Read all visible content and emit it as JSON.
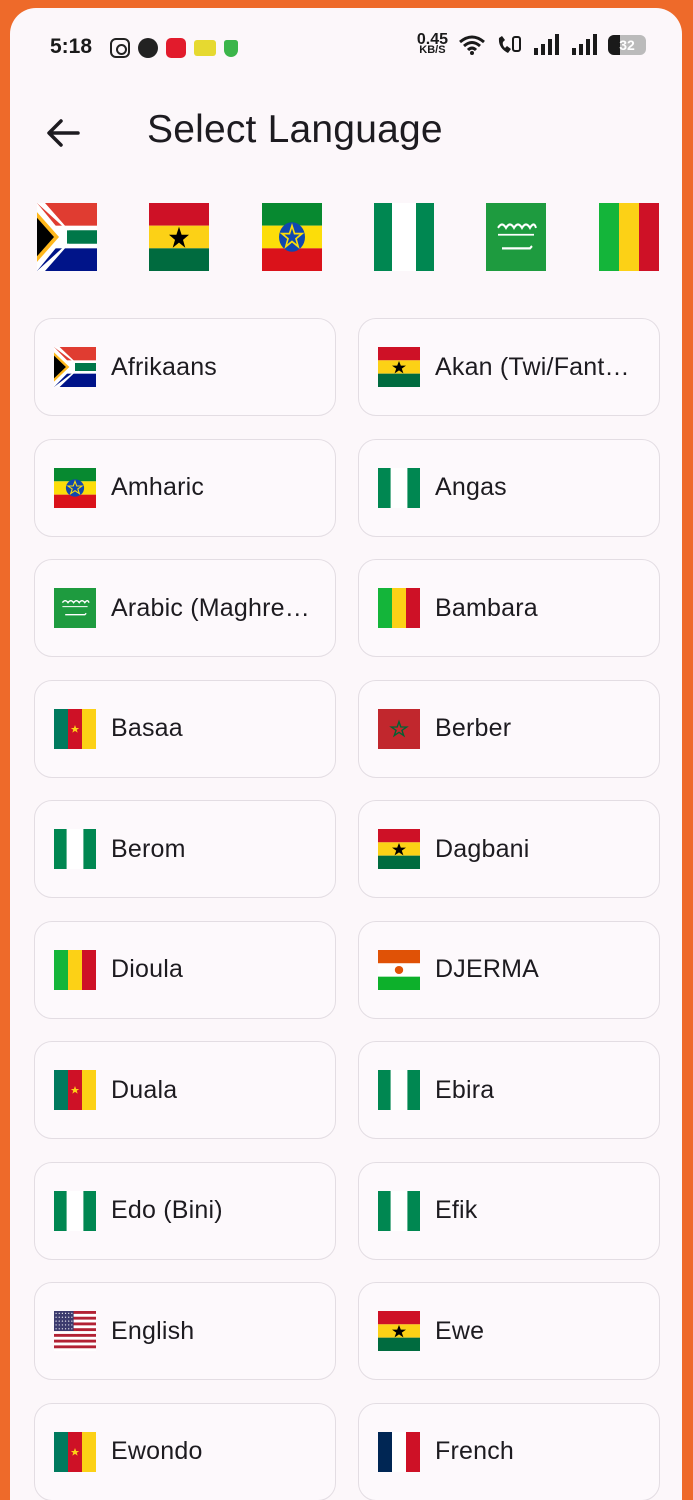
{
  "status_bar": {
    "time": "5:18",
    "net_speed_value": "0.45",
    "net_speed_unit": "KB/S",
    "battery": "32"
  },
  "app_bar": {
    "title": "Select Language"
  },
  "flag_strip": [
    "south-africa-flag-icon",
    "ghana-flag-icon",
    "ethiopia-flag-icon",
    "nigeria-flag-icon",
    "saudi-arabia-flag-icon",
    "mali-flag-icon"
  ],
  "languages": [
    {
      "label": "Afrikaans",
      "flag": "south-africa-flag-icon"
    },
    {
      "label": "Akan (Twi/Fant…",
      "flag": "ghana-flag-icon"
    },
    {
      "label": "Amharic",
      "flag": "ethiopia-flag-icon"
    },
    {
      "label": "Angas",
      "flag": "nigeria-flag-icon"
    },
    {
      "label": "Arabic (Maghre…",
      "flag": "saudi-arabia-flag-icon"
    },
    {
      "label": "Bambara",
      "flag": "mali-flag-icon"
    },
    {
      "label": "Basaa",
      "flag": "cameroon-flag-icon"
    },
    {
      "label": "Berber",
      "flag": "morocco-flag-icon"
    },
    {
      "label": "Berom",
      "flag": "nigeria-flag-icon"
    },
    {
      "label": "Dagbani",
      "flag": "ghana-flag-icon"
    },
    {
      "label": "Dioula",
      "flag": "mali-flag-icon"
    },
    {
      "label": "DJERMA",
      "flag": "niger-flag-icon"
    },
    {
      "label": "Duala",
      "flag": "cameroon-flag-icon"
    },
    {
      "label": "Ebira",
      "flag": "nigeria-flag-icon"
    },
    {
      "label": "Edo (Bini)",
      "flag": "nigeria-flag-icon"
    },
    {
      "label": "Efik",
      "flag": "nigeria-flag-icon"
    },
    {
      "label": "English",
      "flag": "usa-flag-icon"
    },
    {
      "label": "Ewe",
      "flag": "ghana-flag-icon"
    },
    {
      "label": "Ewondo",
      "flag": "cameroon-flag-icon"
    },
    {
      "label": "French",
      "flag": "france-flag-icon"
    }
  ]
}
